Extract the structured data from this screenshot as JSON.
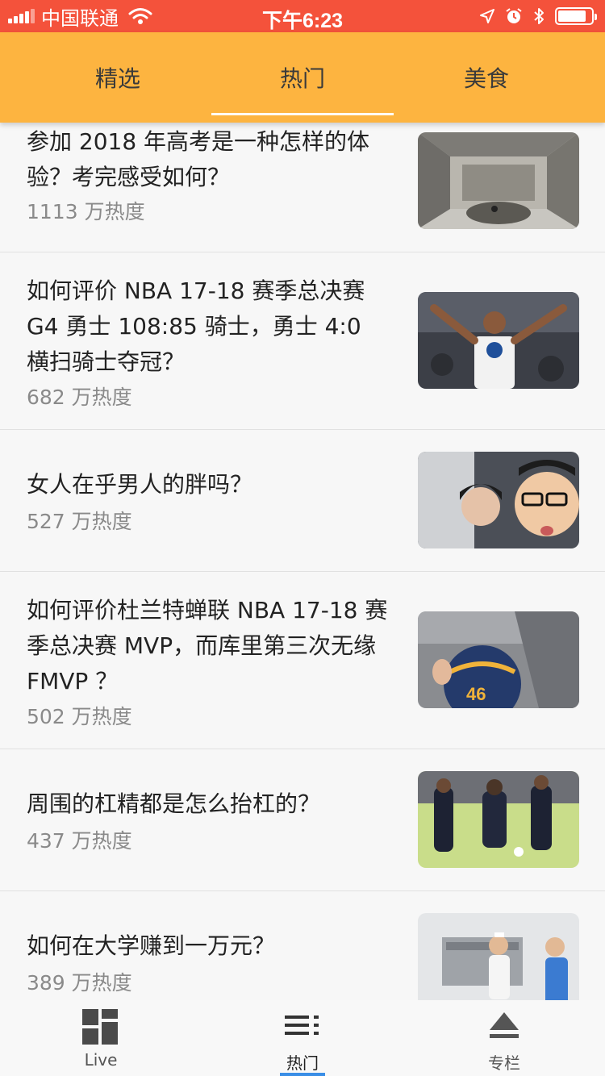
{
  "status_bar": {
    "carrier": "中国联通",
    "time": "下午6:23",
    "icons": [
      "signal-icon",
      "wifi-icon",
      "location-icon",
      "alarm-icon",
      "bluetooth-icon",
      "battery-icon"
    ],
    "battery_level": 0.85
  },
  "top_tabs": {
    "items": [
      {
        "label": "精选"
      },
      {
        "label": "热门"
      },
      {
        "label": "美食"
      }
    ],
    "active": "热门"
  },
  "feed": {
    "items": [
      {
        "title": "参加 2018 年高考是一种怎样的体验？考完感受如何？",
        "heat": "1113 万热度",
        "image": "exam-hall-photo"
      },
      {
        "title": "如何评价 NBA 17-18 赛季总决赛 G4 勇士 108:85 骑士，勇士 4:0 横扫骑士夺冠？",
        "heat": "682 万热度",
        "image": "basketball-player-photo"
      },
      {
        "title": "女人在乎男人的胖吗？",
        "heat": "527 万热度",
        "image": "couple-selfie-photo"
      },
      {
        "title": "如何评价杜兰特蝉联 NBA 17-18 赛季总决赛 MVP，而库里第三次无缘 FMVP ？",
        "heat": "502 万热度",
        "image": "warriors-ball-photo"
      },
      {
        "title": "周围的杠精都是怎么抬杠的？",
        "heat": "437 万热度",
        "image": "soccer-players-photo"
      },
      {
        "title": "如何在大学赚到一万元？",
        "heat": "389 万热度",
        "image": "kitchen-workers-photo"
      }
    ]
  },
  "bottom_nav": {
    "items": [
      {
        "label": "Live",
        "icon": "live-grid-icon"
      },
      {
        "label": "热门",
        "icon": "hot-list-icon"
      },
      {
        "label": "专栏",
        "icon": "column-eject-icon"
      }
    ],
    "active": "热门",
    "active_color": "#3a8ee6"
  },
  "colors": {
    "status_bar": "#f4523b",
    "header": "#fdb440",
    "background": "#f7f7f7"
  }
}
